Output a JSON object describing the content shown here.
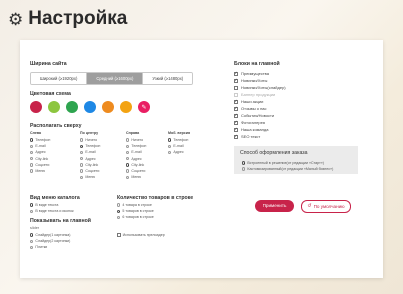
{
  "header": {
    "title": "Настройка",
    "icon": "gear-icon"
  },
  "site_width": {
    "label": "Ширина сайта",
    "options": [
      "Широкий (≥1920px)",
      "Средний (≥1600px)",
      "Узкий (≥1480px)"
    ],
    "selected_index": 1
  },
  "color_scheme": {
    "label": "Цветовая схема",
    "colors": [
      "#c8234a",
      "#8dc63f",
      "#2ea44f",
      "#1e88e5",
      "#ee8b1f",
      "#f3a312",
      "#e91e63"
    ],
    "picker_icon": "eyedropper-icon"
  },
  "top_layout": {
    "label": "Располагать сверху",
    "columns": [
      {
        "title": "Слева",
        "options": [
          "Телефон",
          "E-mail",
          "Адрес",
          "City-link",
          "Соцсети",
          "Меню"
        ],
        "selected": 0
      },
      {
        "title": "По центру",
        "options": [
          "Ничего",
          "Телефон",
          "E-mail",
          "Адрес",
          "City-link",
          "Соцсети",
          "Меню"
        ],
        "selected": 1
      },
      {
        "title": "Справа",
        "options": [
          "Ничего",
          "Телефон",
          "E-mail",
          "Адрес",
          "City-link",
          "Соцсети",
          "Меню"
        ],
        "selected": 4
      },
      {
        "title": "Моб. версия",
        "options": [
          "Телефон",
          "E-mail",
          "Адрес"
        ],
        "selected": 0
      }
    ]
  },
  "catalog_view": {
    "label": "Вид меню каталога",
    "options": [
      "В виде текста",
      "В виде текста и иконок"
    ],
    "selected": 0
  },
  "show_main": {
    "label": "Показывать на главной",
    "slider_label": "slider",
    "options": [
      "Слайдер(1 картинка)",
      "Слайдер(2 картинки)",
      "Плитки"
    ],
    "selected": 0
  },
  "products_per_row": {
    "label": "Количество товаров в строке",
    "options": [
      "4 товара в строке",
      "5 товаров в строке",
      "6 товаров в строке"
    ],
    "selected": 1,
    "preloader_label": "Использовать прелоадер"
  },
  "home_blocks": {
    "label": "Блоки на главной",
    "items": [
      {
        "label": "Преимущества",
        "checked": true,
        "dim": false
      },
      {
        "label": "Новинки/Хиты",
        "checked": true,
        "dim": false
      },
      {
        "label": "Новинки/Хиты(слайдер)",
        "checked": false,
        "dim": false
      },
      {
        "label": "Баннер продукции",
        "checked": false,
        "dim": true
      },
      {
        "label": "Наши акции",
        "checked": true,
        "dim": false
      },
      {
        "label": "Отзывы о нас",
        "checked": true,
        "dim": false
      },
      {
        "label": "События/Новости",
        "checked": true,
        "dim": false
      },
      {
        "label": "Фотогалерея",
        "checked": true,
        "dim": false
      },
      {
        "label": "Наша команда",
        "checked": true,
        "dim": false
      },
      {
        "label": "SEO текст",
        "checked": true,
        "dim": false
      }
    ]
  },
  "order_style": {
    "label": "Способ оформления заказа",
    "options": [
      "Встроенный в решение(от редакции «Старт»)",
      "Кастомизированный(от редакции «Малый бизнес»)"
    ],
    "selected": 0
  },
  "actions": {
    "apply_label": "Применить",
    "default_label": "По умолчанию",
    "default_icon": "undo-icon"
  }
}
